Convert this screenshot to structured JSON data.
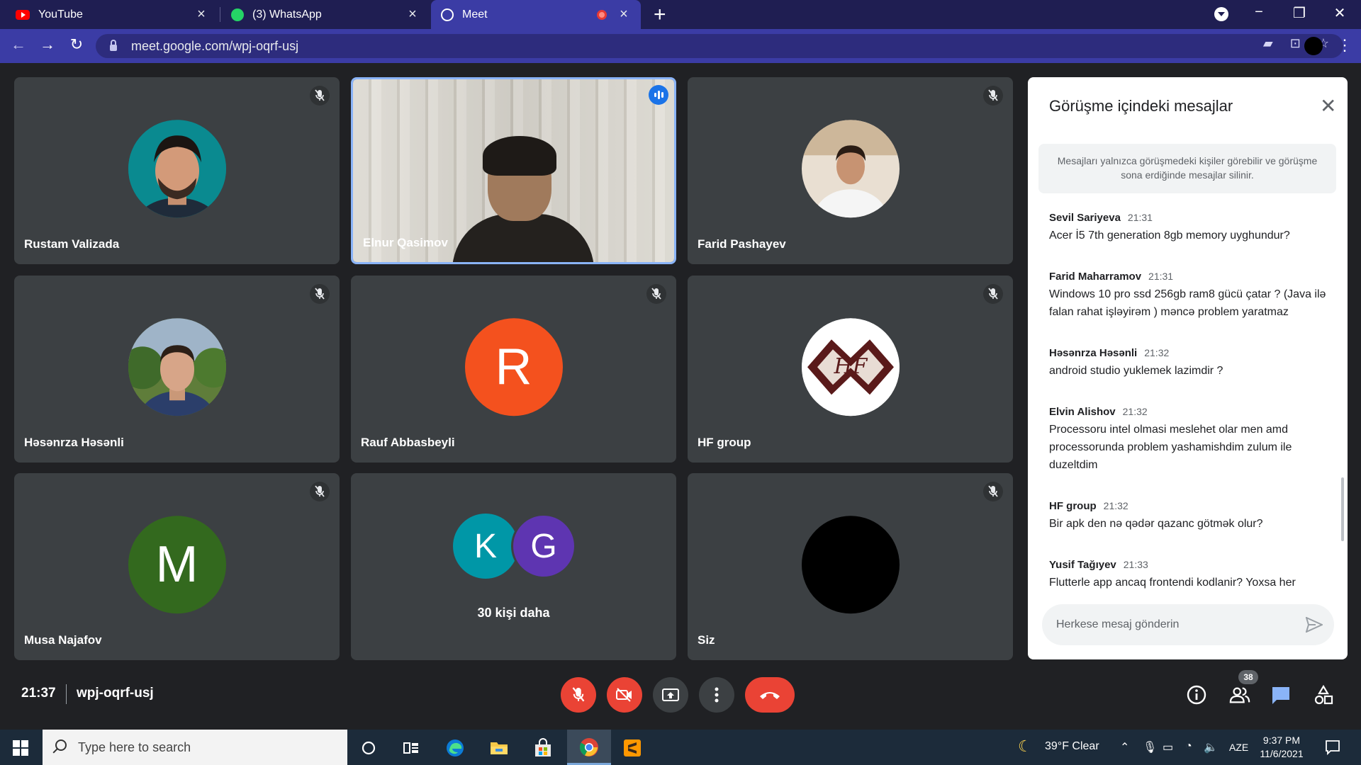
{
  "browser": {
    "tabs": [
      {
        "title": "YouTube",
        "favicon": "youtube-icon"
      },
      {
        "title": "(3) WhatsApp",
        "favicon": "whatsapp-icon"
      },
      {
        "title": "Meet",
        "favicon": "globe-icon",
        "active": true,
        "recording": true
      }
    ],
    "url": "meet.google.com/wpj-oqrf-usj"
  },
  "tiles": [
    {
      "name": "Rustam Valizada",
      "muted": true,
      "avatar": "photo"
    },
    {
      "name": "Elnur Qasimov",
      "speaking": true,
      "avatar": "video"
    },
    {
      "name": "Farid Pashayev",
      "muted": true,
      "avatar": "photo"
    },
    {
      "name": "Həsənrza Həsənli",
      "muted": true,
      "avatar": "photo"
    },
    {
      "name": "Rauf Abbasbeyli",
      "muted": true,
      "avatar": "letter",
      "letter": "R",
      "color": "#f4511e"
    },
    {
      "name": "HF group",
      "muted": true,
      "avatar": "logo",
      "logo_text": "HF"
    },
    {
      "name": "Musa Najafov",
      "muted": true,
      "avatar": "letter",
      "letter": "M",
      "color": "#33691e"
    },
    {
      "name": "30 kişi daha",
      "avatar": "group",
      "letters": [
        "K",
        "G"
      ],
      "colors": [
        "#0097a7",
        "#5e35b1"
      ]
    },
    {
      "name": "Siz",
      "muted": true,
      "avatar": "black"
    }
  ],
  "chat": {
    "title": "Görüşme içindeki mesajlar",
    "info": "Mesajları yalnızca görüşmedeki kişiler görebilir ve görüşme sona erdiğinde mesajlar silinir.",
    "messages": [
      {
        "sender": "Sevil Sariyeva",
        "time": "21:31",
        "text": "Acer İ5 7th generation 8gb memory uyghundur?"
      },
      {
        "sender": "Farid Maharramov",
        "time": "21:31",
        "text": "Windows 10 pro ssd 256gb ram8 gücü çatar ? (Java ilə falan rahat işləyirəm ) məncə problem yaratmaz"
      },
      {
        "sender": "Həsənrza Həsənli",
        "time": "21:32",
        "text": "android studio yuklemek lazimdir ?"
      },
      {
        "sender": "Elvin Alishov",
        "time": "21:32",
        "text": "Processoru intel olmasi meslehet olar men amd processorunda problem yashamishdim zulum ile duzeltdim"
      },
      {
        "sender": "HF group",
        "time": "21:32",
        "text": "Bir apk den nə qədər qazanc götmək olur?"
      },
      {
        "sender": "Yusif Tağıyev",
        "time": "21:33",
        "text": "Flutterle app ancaq frontendi kodlanir? Yoxsa her"
      }
    ],
    "input_placeholder": "Herkese mesaj gönderin"
  },
  "controls": {
    "time": "21:37",
    "meeting_code": "wpj-oqrf-usj",
    "participant_count": "38"
  },
  "taskbar": {
    "search_placeholder": "Type here to search",
    "weather": "39°F  Clear",
    "language": "AZE",
    "time": "9:37 PM",
    "date": "11/6/2021"
  }
}
